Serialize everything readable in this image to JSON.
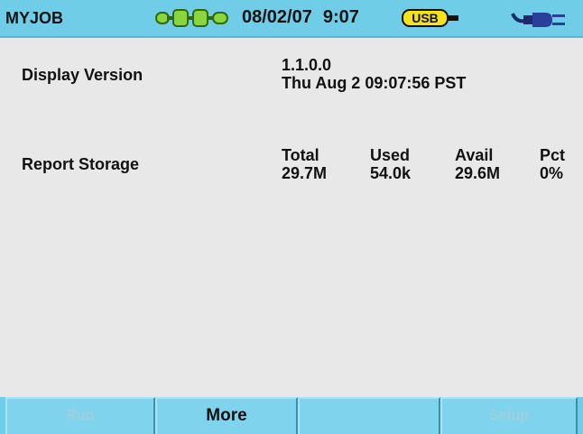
{
  "header": {
    "title": "MYJOB",
    "date": "08/02/07",
    "time": "9:07",
    "usb_label": "USB",
    "icons": {
      "link": "connection-link-icon",
      "usb": "usb-icon",
      "power": "power-plug-icon"
    },
    "colors": {
      "bar": "#70cde8",
      "link_green": "#8bd63a"
    }
  },
  "display_version": {
    "label": "Display Version",
    "version": "1.1.0.0",
    "build_date": "Thu Aug 2 09:07:56 PST"
  },
  "report_storage": {
    "label": "Report Storage",
    "columns": [
      {
        "header": "Total",
        "value": "29.7M"
      },
      {
        "header": "Used",
        "value": "54.0k"
      },
      {
        "header": "Avail",
        "value": "29.6M"
      },
      {
        "header": "Pct",
        "value": "0%"
      }
    ]
  },
  "softkeys": [
    {
      "label": "Run",
      "enabled": false
    },
    {
      "label": "More",
      "enabled": true
    },
    {
      "label": "",
      "enabled": false
    },
    {
      "label": "Setup",
      "enabled": false
    }
  ]
}
